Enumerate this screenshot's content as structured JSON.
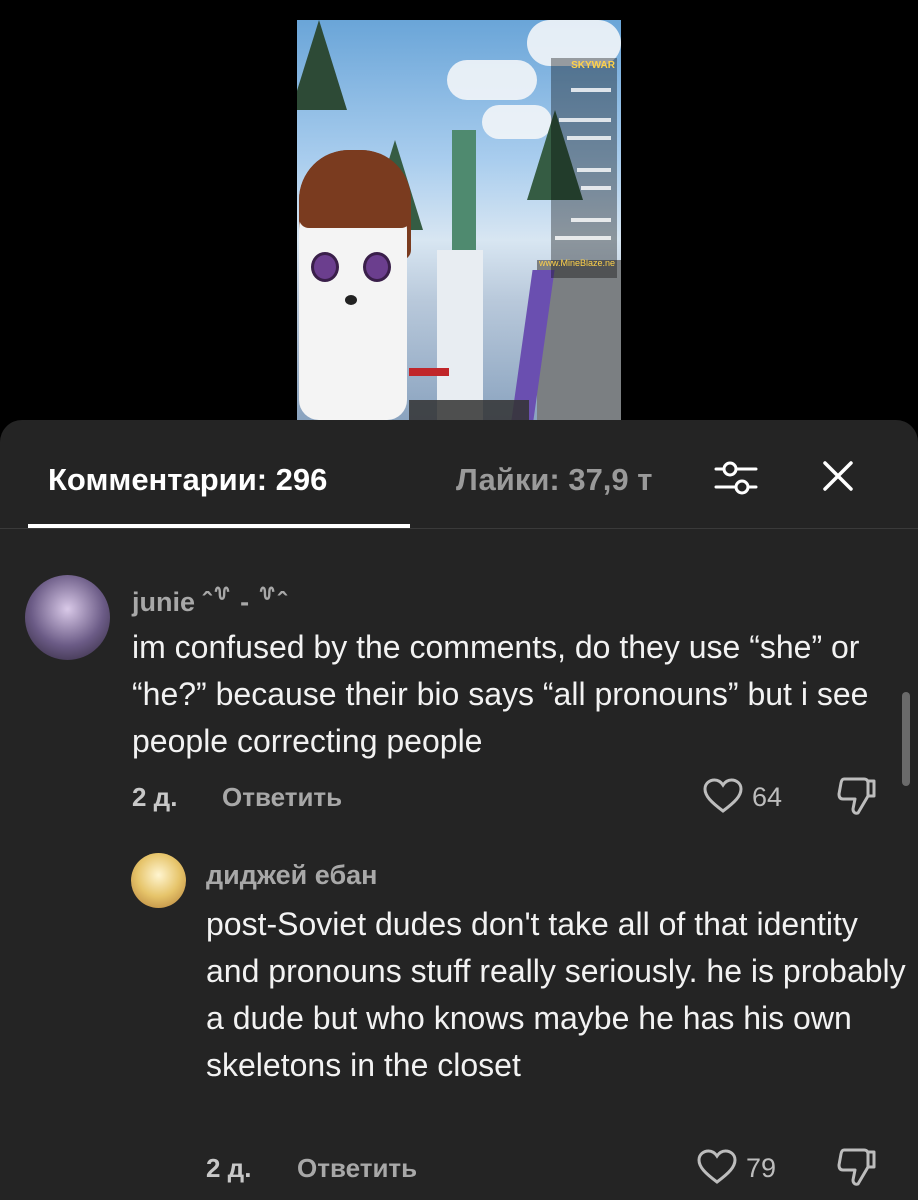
{
  "video": {
    "hud_brand": "SKYWAR",
    "hud_site": "www.MineBlaze.ne"
  },
  "tabs": {
    "comments_label": "Комментарии: 296",
    "likes_label": "Лайки: 37,9 т"
  },
  "icons": {
    "filter": "sliders-icon",
    "close": "close-icon",
    "like": "heart-icon",
    "dislike": "thumbs-down-icon"
  },
  "comments": [
    {
      "username": "junie ˆ꒷ - ꒷ˆ",
      "text": "im confused by the comments, do they use “she” or “he?” because their bio says “all pronouns” but i see people correcting people",
      "time": "2 д.",
      "reply_label": "Ответить",
      "likes": "64"
    },
    {
      "username": "диджей ебан",
      "text": "post-Soviet dudes don't take all of that identity and pronouns stuff really seriously. he is probably a dude but who knows maybe he has his own skeletons in the closet",
      "time": "2 д.",
      "reply_label": "Ответить",
      "likes": "79"
    }
  ]
}
